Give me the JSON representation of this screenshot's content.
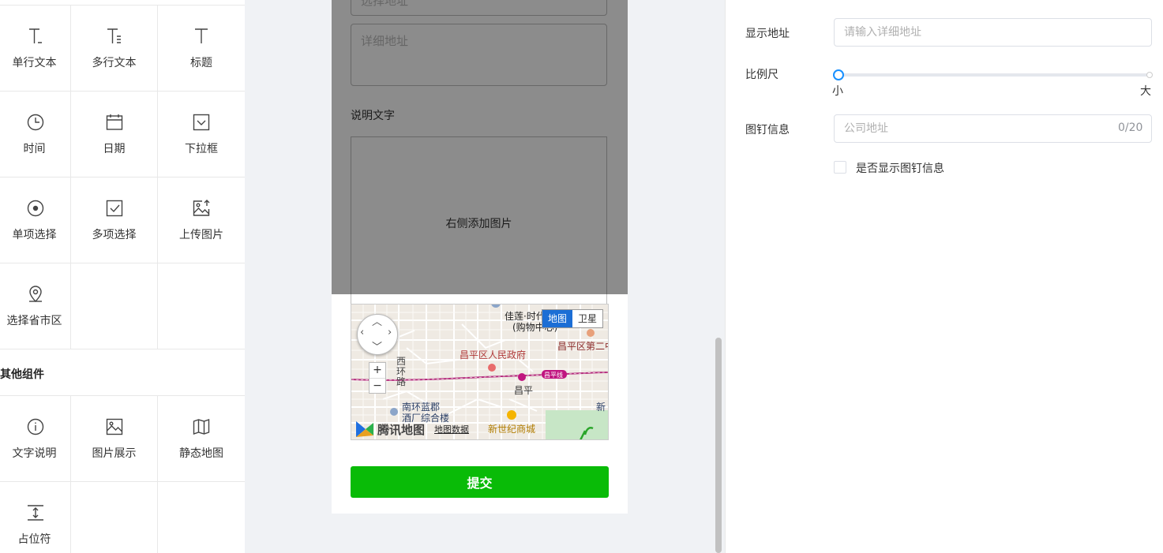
{
  "palette": {
    "basic_items": [
      {
        "label": "单行文本",
        "icon": "text-single-icon"
      },
      {
        "label": "多行文本",
        "icon": "text-multi-icon"
      },
      {
        "label": "标题",
        "icon": "title-icon"
      },
      {
        "label": "时间",
        "icon": "clock-icon"
      },
      {
        "label": "日期",
        "icon": "calendar-icon"
      },
      {
        "label": "下拉框",
        "icon": "dropdown-icon"
      },
      {
        "label": "单项选择",
        "icon": "radio-icon"
      },
      {
        "label": "多项选择",
        "icon": "checkbox-icon"
      },
      {
        "label": "上传图片",
        "icon": "upload-image-icon"
      },
      {
        "label": "选择省市区",
        "icon": "location-pin-icon"
      }
    ],
    "other_section_title": "其他组件",
    "other_items": [
      {
        "label": "文字说明",
        "icon": "info-icon"
      },
      {
        "label": "图片展示",
        "icon": "image-icon"
      },
      {
        "label": "静态地图",
        "icon": "map-icon"
      },
      {
        "label": "占位符",
        "icon": "placeholder-icon"
      }
    ]
  },
  "canvas": {
    "select_placeholder": "选择地址",
    "detail_address_placeholder": "详细地址",
    "description_label": "说明文字",
    "image_placeholder": "右侧添加图片",
    "map": {
      "type_map": "地图",
      "type_satellite": "卫星",
      "labels": {
        "poi1": "佳莲·时代",
        "poi1b": "(购物中心)",
        "poi2": "昌平区第二中",
        "gov": "昌平区人民政府",
        "road1": "西",
        "road2": "环",
        "road3": "路",
        "station": "昌平",
        "line": "昌平线",
        "south": "南环蓝郡",
        "south2": "酒厂综合楼",
        "mall": "新世纪商城",
        "new": "新",
        "brand": "腾讯地图",
        "data": "地图数据"
      },
      "zoom_in": "+",
      "zoom_out": "−"
    },
    "submit_label": "提交"
  },
  "properties": {
    "display_address_label": "显示地址",
    "display_address_placeholder": "请输入详细地址",
    "scale_label": "比例尺",
    "scale_min": "小",
    "scale_max": "大",
    "scale_value": 0,
    "pin_info_label": "图钉信息",
    "pin_info_placeholder": "公司地址",
    "pin_info_counter": "0/20",
    "show_pin_label": "是否显示图钉信息",
    "show_pin_checked": false
  },
  "colors": {
    "accent": "#1890ff",
    "submit_bg": "#09bb07",
    "overlay": "rgba(0,0,0,0.45)"
  }
}
